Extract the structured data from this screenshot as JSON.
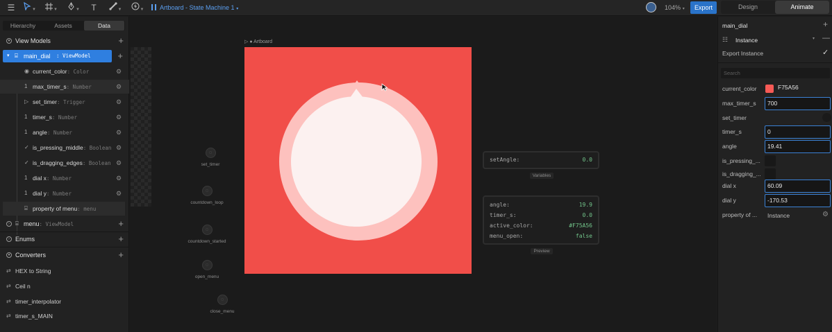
{
  "topbar": {
    "breadcrumb": "Artboard - State Machine 1",
    "zoom": "104%",
    "export_label": "Export",
    "tabs": [
      "Design",
      "Animate"
    ],
    "active_tab": "Animate"
  },
  "left": {
    "tabs": [
      "Hierarchy",
      "Assets",
      "Data"
    ],
    "active_tab": "Data",
    "view_models_label": "View Models",
    "main_vm": {
      "name": "main_dial",
      "type": ": ViewModel"
    },
    "props": [
      {
        "icon": "eye",
        "name": "current_color",
        "type": ": Color"
      },
      {
        "icon": "1",
        "name": "max_timer_s",
        "type": ": Number"
      },
      {
        "icon": "▷",
        "name": "set_timer",
        "type": ": Trigger"
      },
      {
        "icon": "1",
        "name": "timer_s",
        "type": ": Number"
      },
      {
        "icon": "1",
        "name": "angle",
        "type": ": Number"
      },
      {
        "icon": "✓",
        "name": "is_pressing_middle",
        "type": ": Boolean"
      },
      {
        "icon": "✓",
        "name": "is_dragging_edges",
        "type": ": Boolean"
      },
      {
        "icon": "1",
        "name": "dial x",
        "type": ": Number"
      },
      {
        "icon": "1",
        "name": "dial y",
        "type": ": Number"
      },
      {
        "icon": "vm",
        "name": "property of menu",
        "type": ": menu"
      }
    ],
    "menu_vm": {
      "name": "menu",
      "type": ": ViewModel"
    },
    "enums_label": "Enums",
    "converters_label": "Converters",
    "converters": [
      "HEX to String",
      "Ceil n",
      "timer_interpolator",
      "timer_s_MAIN"
    ]
  },
  "canvas": {
    "artboard_label": "Artboard",
    "artboard_color": "#F14E49",
    "ring_color": "#FDC1BE",
    "face_color": "#FCF1F0",
    "nodes": [
      "set_timer",
      "countdown_loop",
      "countdown_started",
      "open_menu",
      "close_menu"
    ],
    "variables_panel": {
      "caption": "Variables",
      "rows": [
        {
          "key": "setAngle:",
          "value": "0.0"
        }
      ]
    },
    "preview_panel": {
      "caption": "Preview",
      "rows": [
        {
          "key": "angle:",
          "value": "19.9"
        },
        {
          "key": "timer_s:",
          "value": "0.0"
        },
        {
          "key": "active_color:",
          "value": "#F75A56"
        },
        {
          "key": "menu_open:",
          "value": "false"
        }
      ]
    }
  },
  "right": {
    "title": "main_dial",
    "instance_label": "Instance",
    "export_instance_label": "Export Instance",
    "search_placeholder": "Search",
    "current_color_label": "current_color",
    "current_color_value": "F75A56",
    "current_color_hex": "#F75A56",
    "max_timer_label": "max_timer_s",
    "max_timer_value": "700",
    "set_timer_label": "set_timer",
    "timer_s_label": "timer_s",
    "timer_s_value": "0",
    "angle_label": "angle",
    "angle_value": "19.41",
    "is_pressing_label": "is_pressing_...",
    "is_dragging_label": "is_dragging_...",
    "dial_x_label": "dial x",
    "dial_x_value": "60.09",
    "dial_y_label": "dial y",
    "dial_y_value": "-170.53",
    "property_of_label": "property of ...",
    "property_of_value": "Instance"
  }
}
